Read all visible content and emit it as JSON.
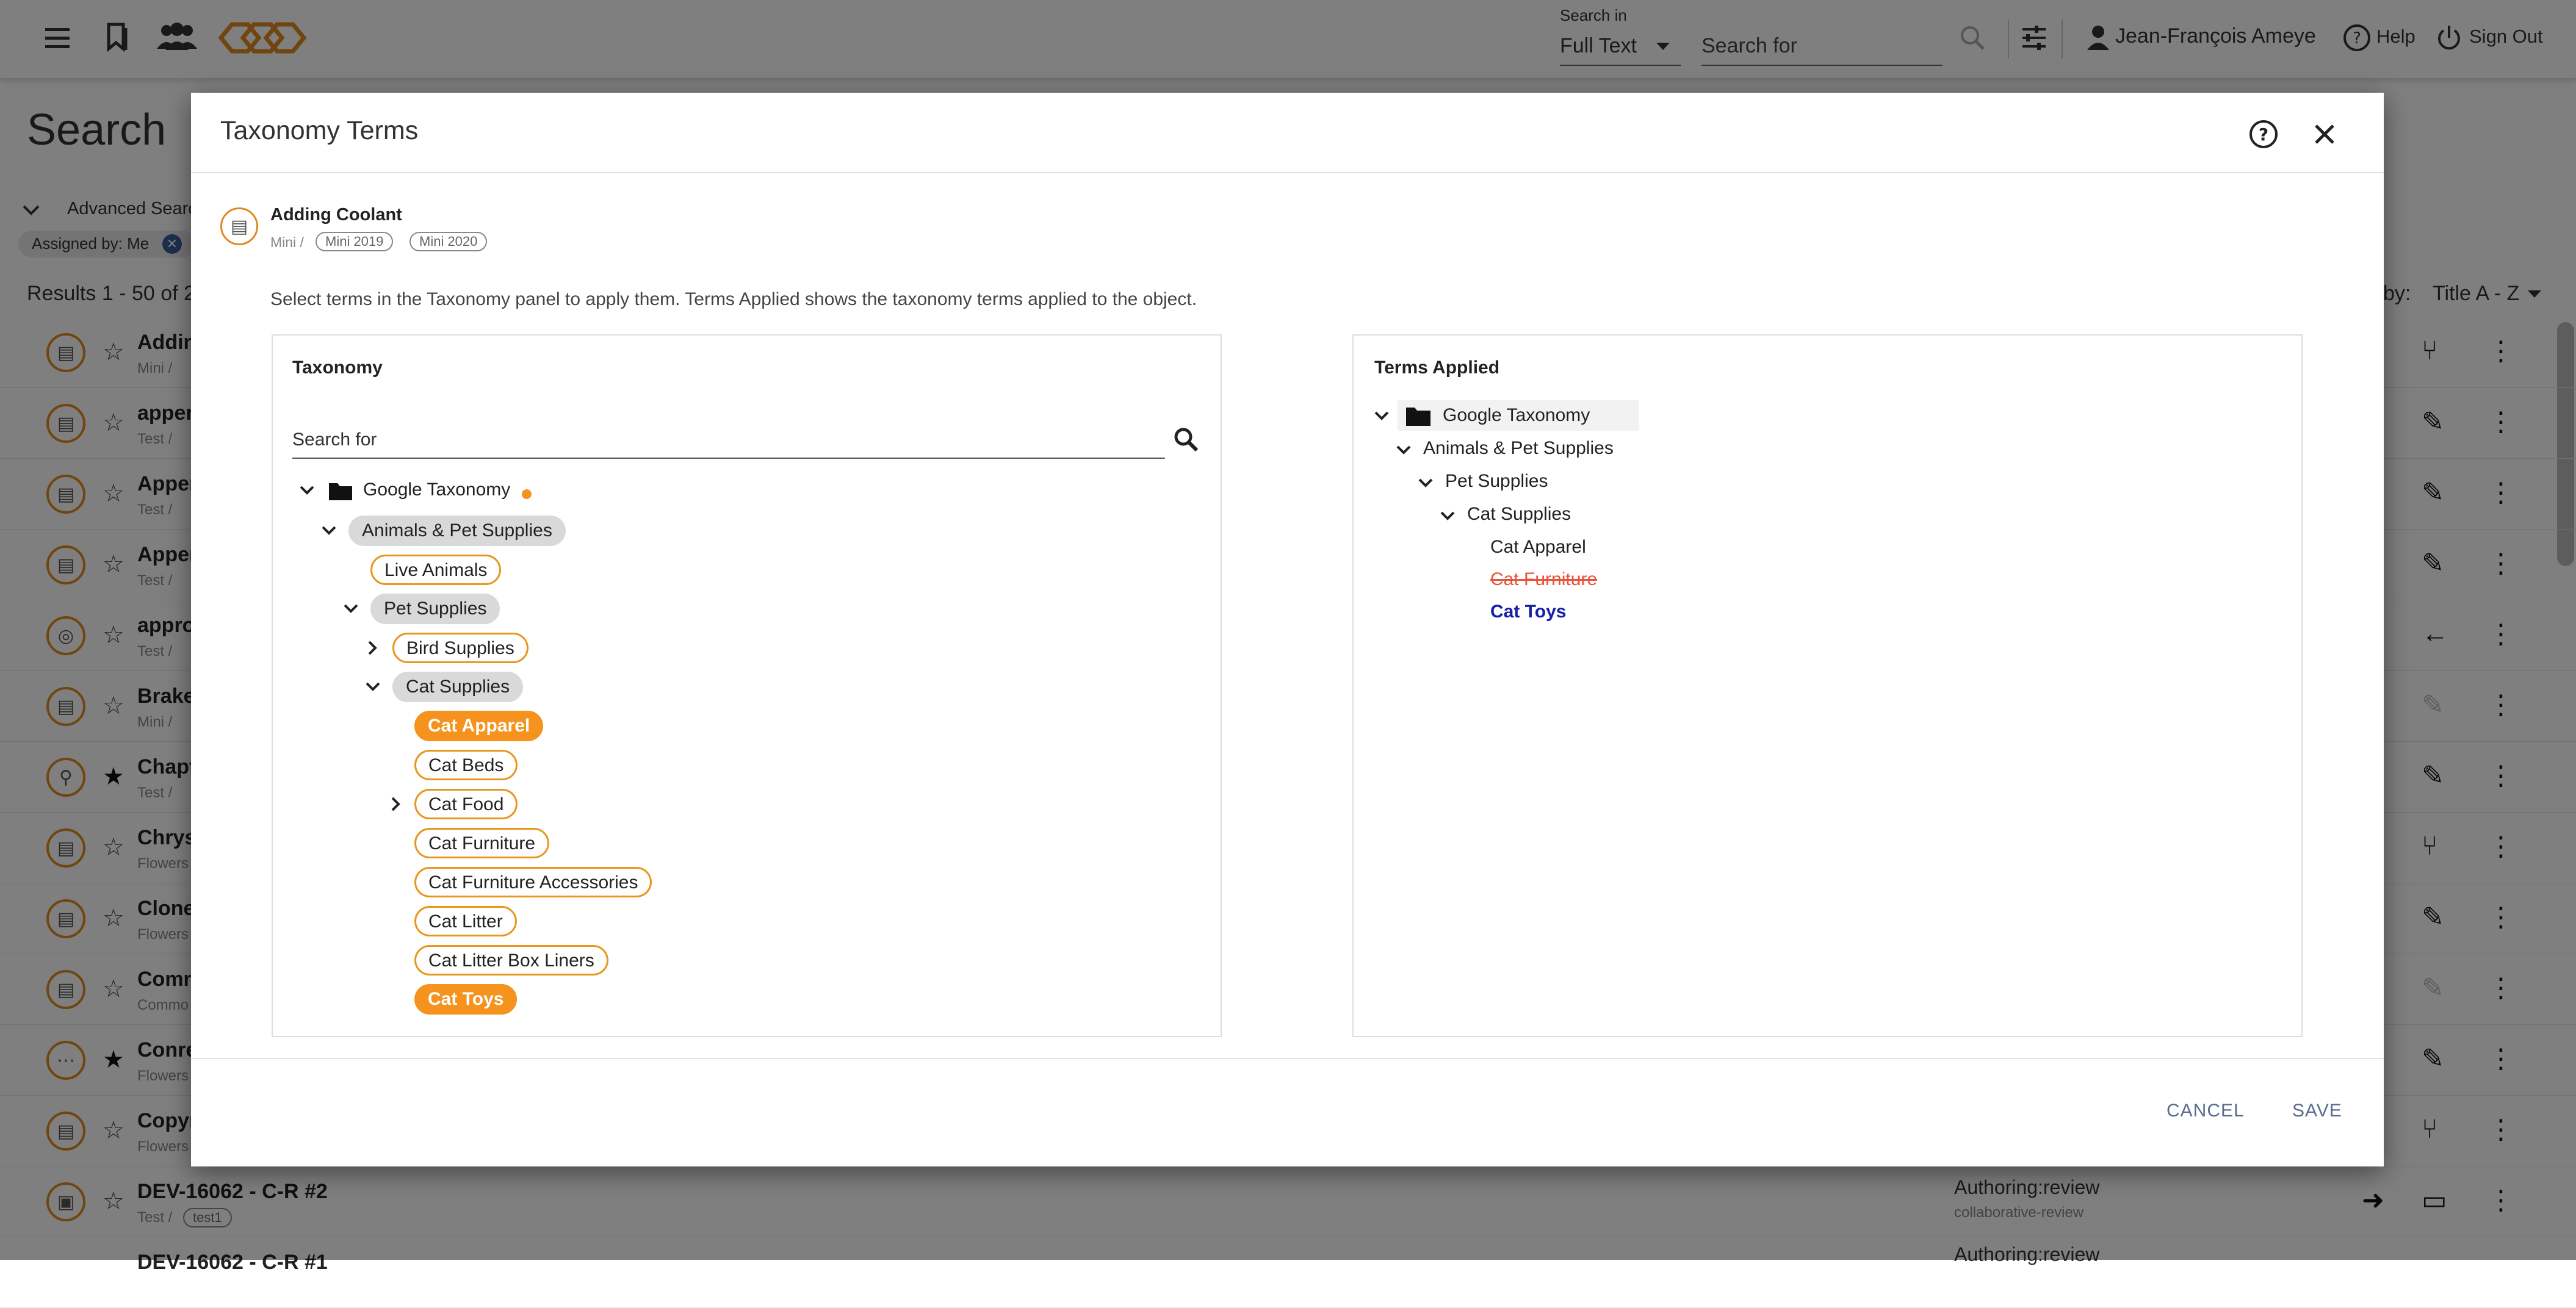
{
  "topbar": {
    "search_in_label": "Search in",
    "search_in_value": "Full Text",
    "search_placeholder": "Search for",
    "user_name": "Jean-François Ameye",
    "help": "Help",
    "sign_out": "Sign Out"
  },
  "background": {
    "page_title": "Search",
    "advanced_search": "Advanced Search",
    "filter_chip": "Assigned by: Me",
    "results": "Results 1 - 50 of 2",
    "sort_label": "by:",
    "sort_value": "Title A - Z",
    "rows": [
      {
        "title": "Addin",
        "sub": "Mini /"
      },
      {
        "title": "apper",
        "sub": "Test /"
      },
      {
        "title": "Apper",
        "sub": "Test /"
      },
      {
        "title": "Apper",
        "sub": "Test /"
      },
      {
        "title": "appro",
        "sub": "Test /"
      },
      {
        "title": "Brake",
        "sub": "Mini /"
      },
      {
        "title": "Chapt",
        "sub": "Test /"
      },
      {
        "title": "Chrys",
        "sub": "Flowers"
      },
      {
        "title": "Clone",
        "sub": "Flowers"
      },
      {
        "title": "Comm",
        "sub": "Commo"
      },
      {
        "title": "Conre",
        "sub": "Flowers"
      },
      {
        "title": "Copyr",
        "sub": "Flowers"
      },
      {
        "title": "DEV-16062 - C-R #2",
        "sub": "Test /",
        "chip": "test1",
        "status": "Authoring:review",
        "status_sub": "collaborative-review"
      },
      {
        "title": "DEV-16062 - C-R #1",
        "sub": "",
        "status": "Authoring:review"
      }
    ]
  },
  "modal": {
    "title": "Taxonomy Terms",
    "object_title": "Adding Coolant",
    "object_path": "Mini /",
    "object_chips": [
      "Mini 2019",
      "Mini 2020"
    ],
    "instructions": "Select terms in the Taxonomy panel to apply them. Terms Applied shows the taxonomy terms applied to the object.",
    "taxonomy_panel": {
      "title": "Taxonomy",
      "search_placeholder": "Search for",
      "root": "Google Taxonomy",
      "animals": "Animals & Pet Supplies",
      "live_animals": "Live Animals",
      "pet_supplies": "Pet Supplies",
      "bird_supplies": "Bird Supplies",
      "cat_supplies": "Cat Supplies",
      "cat_apparel": "Cat Apparel",
      "cat_beds": "Cat Beds",
      "cat_food": "Cat Food",
      "cat_furniture": "Cat Furniture",
      "cat_furniture_accessories": "Cat Furniture Accessories",
      "cat_litter": "Cat Litter",
      "cat_litter_box_liners": "Cat Litter Box Liners",
      "cat_toys": "Cat Toys"
    },
    "applied_panel": {
      "title": "Terms Applied",
      "root": "Google Taxonomy",
      "animals": "Animals & Pet Supplies",
      "pet_supplies": "Pet Supplies",
      "cat_supplies": "Cat Supplies",
      "cat_apparel": "Cat Apparel",
      "cat_furniture": "Cat Furniture",
      "cat_toys": "Cat Toys"
    },
    "cancel": "CANCEL",
    "save": "SAVE"
  },
  "colors": {
    "accent_orange": "#f5931e",
    "removed_red": "#e8533a",
    "added_blue": "#1520a6"
  }
}
